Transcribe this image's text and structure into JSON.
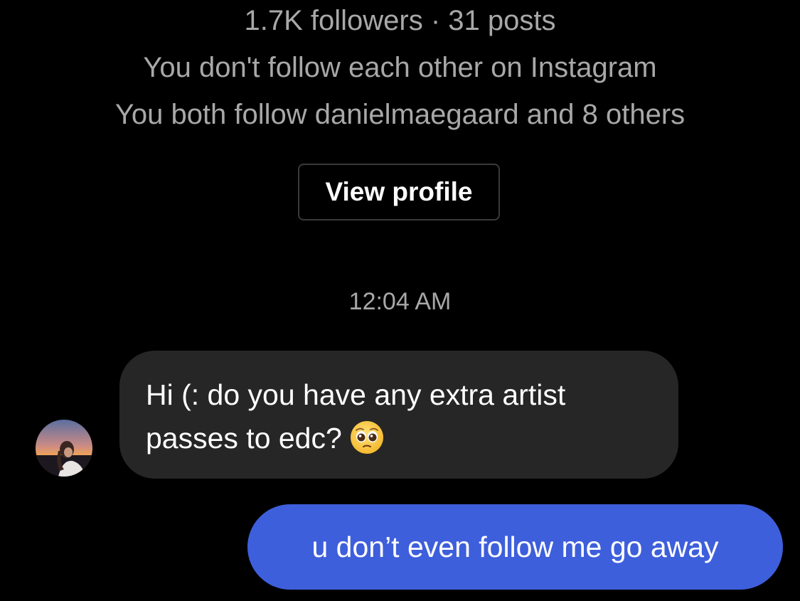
{
  "profile": {
    "stats_line": "1.7K followers · 31 posts",
    "relationship_line": "You don't follow each other on Instagram",
    "mutuals_line": "You both follow danielmaegaard and 8 others",
    "view_profile_label": "View profile"
  },
  "thread": {
    "timestamp": "12:04 AM",
    "messages": [
      {
        "direction": "incoming",
        "line1": "Hi (: do you have any extra artist",
        "line2": "passes to edc?",
        "emoji": "pleading-face-icon"
      },
      {
        "direction": "outgoing",
        "text": "u don’t even follow me go away"
      }
    ]
  },
  "colors": {
    "background": "#000000",
    "secondary_text": "#a8a8a8",
    "incoming_bubble": "#262626",
    "outgoing_bubble": "#3e5fdb",
    "button_border": "#3a3a3a"
  }
}
